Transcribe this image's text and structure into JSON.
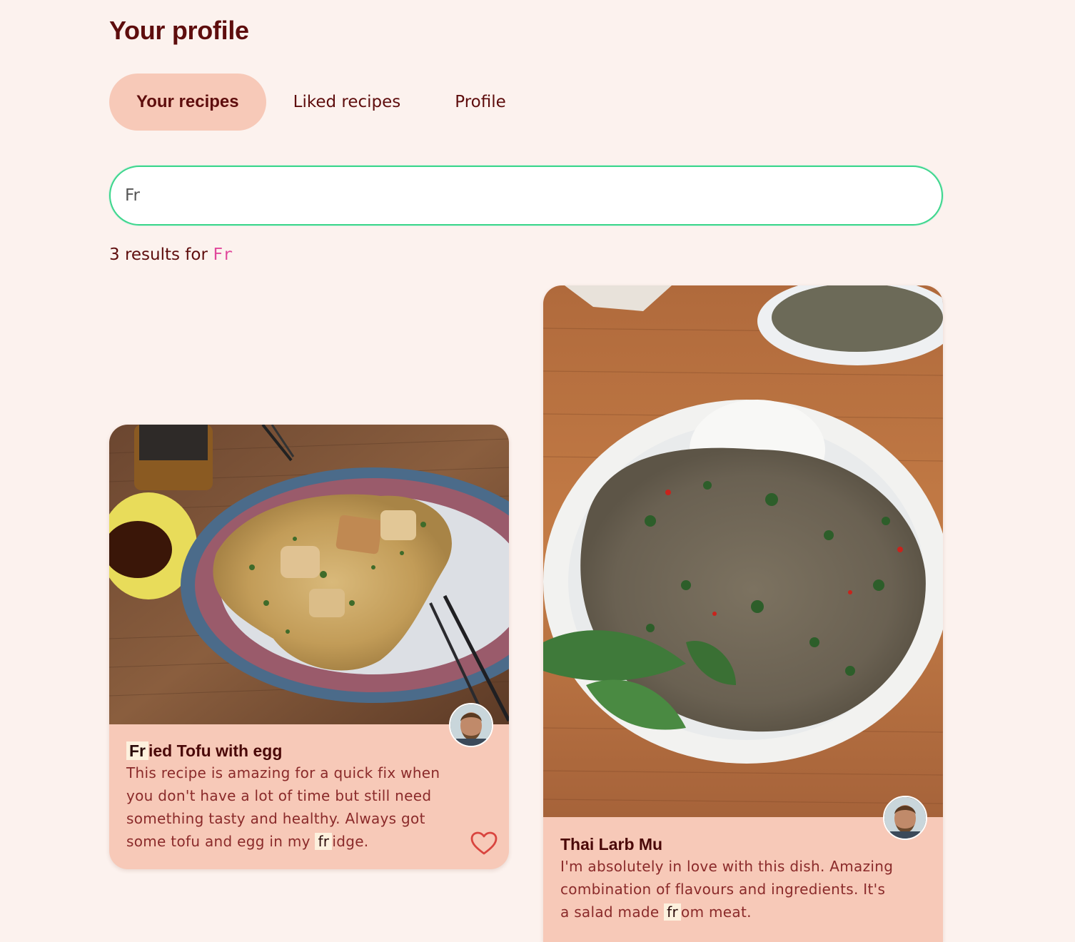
{
  "page": {
    "title": "Your profile"
  },
  "tabs": [
    {
      "label": "Your recipes",
      "active": true
    },
    {
      "label": "Liked recipes",
      "active": false
    },
    {
      "label": "Profile",
      "active": false
    }
  ],
  "search": {
    "value": "Fr",
    "placeholder": ""
  },
  "results": {
    "count_text": "3 results for",
    "query": "Fr"
  },
  "recipes": [
    {
      "title_highlight": "Fr",
      "title_rest": "ied Tofu with egg",
      "desc_before": "This recipe is amazing for a quick fix when you don't have a lot of time but still need something tasty and healthy. Always got some tofu and egg in my ",
      "desc_highlight": "fr",
      "desc_after": "idge.",
      "liked": false,
      "image_icon": "fried-tofu-photo"
    },
    {
      "title": "Thai Larb Mu",
      "desc_before": "I'm absolutely in love with this dish. Amazing combination of flavours and ingredients. It's a salad made ",
      "desc_highlight": "fr",
      "desc_after": "om meat.",
      "image_icon": "larb-mu-photo"
    }
  ],
  "colors": {
    "background": "#fcf2ee",
    "card": "#f7c9b8",
    "accent_text": "#5e0d0d",
    "search_border": "#3dd68c",
    "query": "#e0479b",
    "heart": "#d9453f"
  }
}
